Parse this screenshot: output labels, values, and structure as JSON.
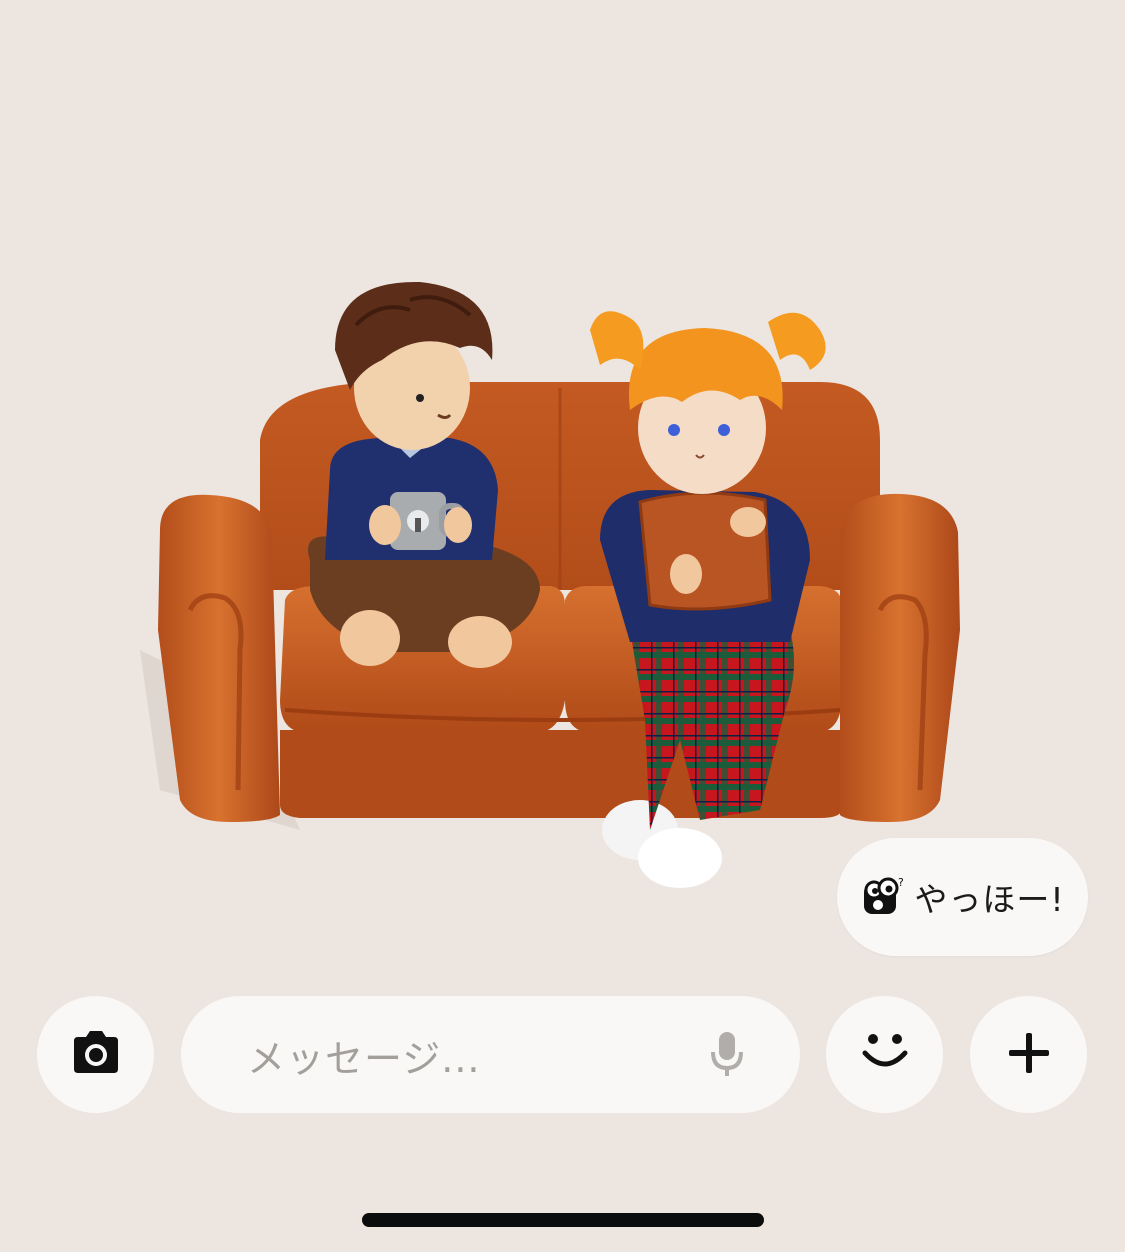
{
  "scene": {
    "description_icons": [
      "sofa-illustration",
      "avatar-boy",
      "avatar-girl"
    ]
  },
  "speech_bubble": {
    "icon": "googly-eyes-icon",
    "text": "やっほー!"
  },
  "composer": {
    "camera_icon": "camera-icon",
    "placeholder": "メッセージ...",
    "mic_icon": "microphone-icon",
    "emoji_icon": "smiley-icon",
    "add_icon": "plus-icon"
  },
  "colors": {
    "background": "#ece5e0",
    "button_bg": "#faf8f6",
    "sofa": "#c8602a",
    "placeholder_text": "#a3a09c"
  }
}
